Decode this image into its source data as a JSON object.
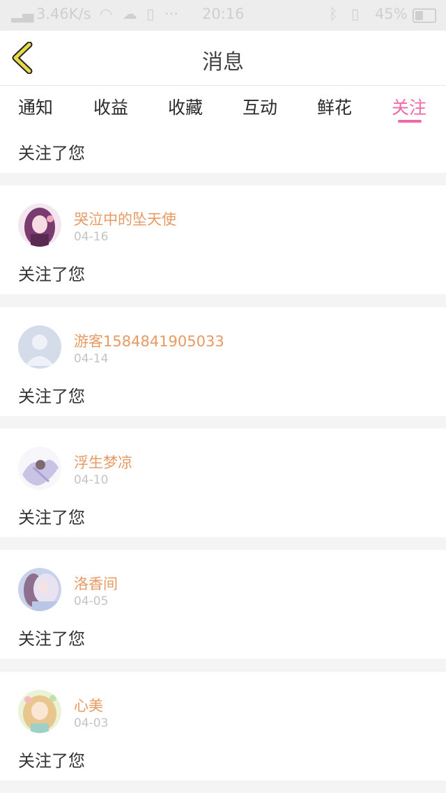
{
  "status_bar": {
    "network_speed": "3.46K/s",
    "time": "20:16",
    "battery": "45%"
  },
  "header": {
    "title": "消息"
  },
  "tabs": [
    {
      "label": "通知"
    },
    {
      "label": "收益"
    },
    {
      "label": "收藏"
    },
    {
      "label": "互动"
    },
    {
      "label": "鲜花"
    },
    {
      "label": "关注",
      "active": true
    }
  ],
  "messages": [
    {
      "text": "关注了您"
    },
    {
      "user": "哭泣中的坠天使",
      "date": "04-16",
      "text": "关注了您"
    },
    {
      "user": "游客1584841905033",
      "date": "04-14",
      "text": "关注了您"
    },
    {
      "user": "浮生梦凉",
      "date": "04-10",
      "text": "关注了您"
    },
    {
      "user": "洛香间",
      "date": "04-05",
      "text": "关注了您"
    },
    {
      "user": "心美",
      "date": "04-03",
      "text": "关注了您"
    }
  ],
  "colors": {
    "accent": "#ee6aa7",
    "username": "#e79a63",
    "date": "#c4c4c4",
    "back_icon": "#e8d94a"
  }
}
